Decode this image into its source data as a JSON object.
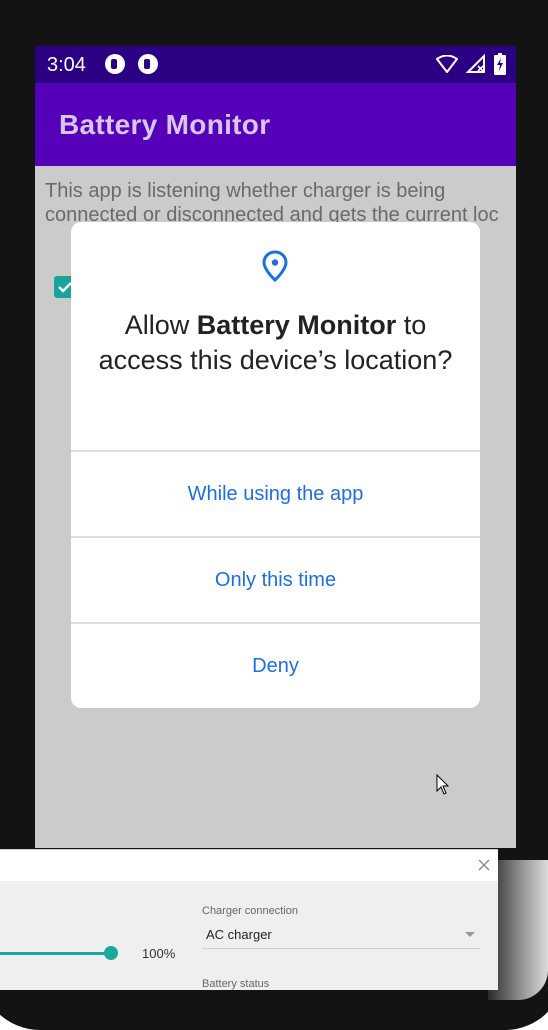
{
  "status_bar": {
    "time": "3:04"
  },
  "app_bar": {
    "title": "Battery Monitor"
  },
  "content": {
    "description": "This app is listening whether charger is being connected or disconnected and gets the current loc",
    "checkbox_checked": true
  },
  "dialog": {
    "title_prefix": "Allow ",
    "app_name": "Battery Monitor",
    "title_suffix": " to access this device’s location?",
    "buttons": {
      "while_using": "While using the app",
      "only_this_time": "Only this time",
      "deny": "Deny"
    }
  },
  "emulator_panel": {
    "battery_level": "100%",
    "charger_connection_label": "Charger connection",
    "charger_connection_value": "AC charger",
    "battery_status_label": "Battery status"
  },
  "colors": {
    "status_bar": "#2c0083",
    "app_bar": "#5500b9",
    "accent_link": "#1b6fe0",
    "teal": "#1ba89d"
  }
}
